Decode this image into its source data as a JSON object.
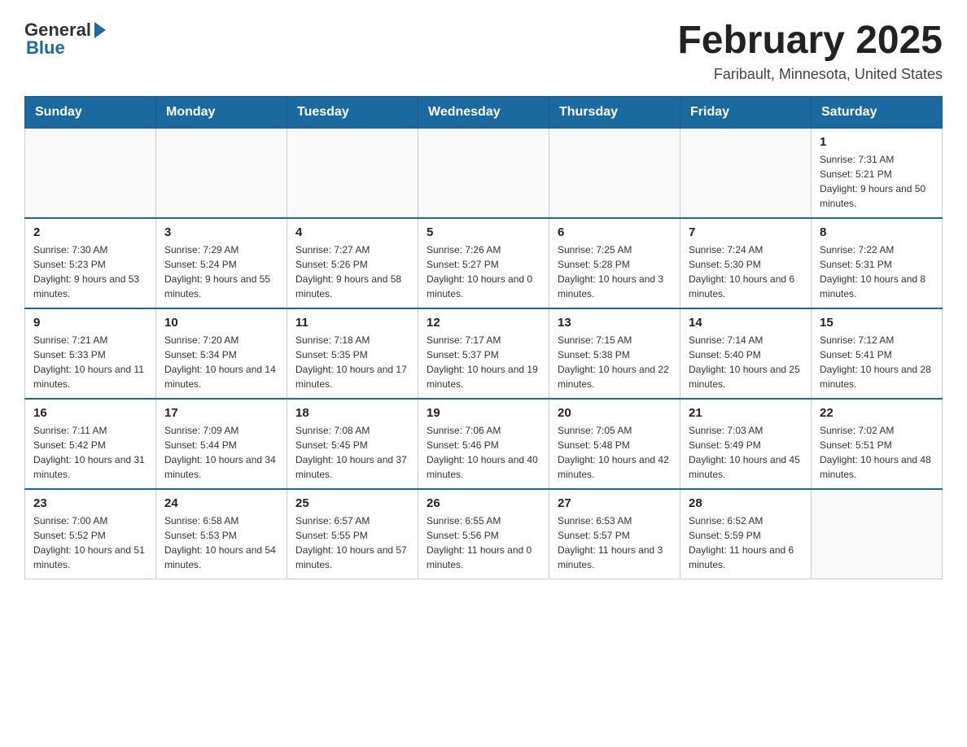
{
  "header": {
    "logo_general": "General",
    "logo_blue": "Blue",
    "month_year": "February 2025",
    "location": "Faribault, Minnesota, United States"
  },
  "days_of_week": [
    "Sunday",
    "Monday",
    "Tuesday",
    "Wednesday",
    "Thursday",
    "Friday",
    "Saturday"
  ],
  "weeks": [
    [
      {
        "day": "",
        "info": ""
      },
      {
        "day": "",
        "info": ""
      },
      {
        "day": "",
        "info": ""
      },
      {
        "day": "",
        "info": ""
      },
      {
        "day": "",
        "info": ""
      },
      {
        "day": "",
        "info": ""
      },
      {
        "day": "1",
        "info": "Sunrise: 7:31 AM\nSunset: 5:21 PM\nDaylight: 9 hours and 50 minutes."
      }
    ],
    [
      {
        "day": "2",
        "info": "Sunrise: 7:30 AM\nSunset: 5:23 PM\nDaylight: 9 hours and 53 minutes."
      },
      {
        "day": "3",
        "info": "Sunrise: 7:29 AM\nSunset: 5:24 PM\nDaylight: 9 hours and 55 minutes."
      },
      {
        "day": "4",
        "info": "Sunrise: 7:27 AM\nSunset: 5:26 PM\nDaylight: 9 hours and 58 minutes."
      },
      {
        "day": "5",
        "info": "Sunrise: 7:26 AM\nSunset: 5:27 PM\nDaylight: 10 hours and 0 minutes."
      },
      {
        "day": "6",
        "info": "Sunrise: 7:25 AM\nSunset: 5:28 PM\nDaylight: 10 hours and 3 minutes."
      },
      {
        "day": "7",
        "info": "Sunrise: 7:24 AM\nSunset: 5:30 PM\nDaylight: 10 hours and 6 minutes."
      },
      {
        "day": "8",
        "info": "Sunrise: 7:22 AM\nSunset: 5:31 PM\nDaylight: 10 hours and 8 minutes."
      }
    ],
    [
      {
        "day": "9",
        "info": "Sunrise: 7:21 AM\nSunset: 5:33 PM\nDaylight: 10 hours and 11 minutes."
      },
      {
        "day": "10",
        "info": "Sunrise: 7:20 AM\nSunset: 5:34 PM\nDaylight: 10 hours and 14 minutes."
      },
      {
        "day": "11",
        "info": "Sunrise: 7:18 AM\nSunset: 5:35 PM\nDaylight: 10 hours and 17 minutes."
      },
      {
        "day": "12",
        "info": "Sunrise: 7:17 AM\nSunset: 5:37 PM\nDaylight: 10 hours and 19 minutes."
      },
      {
        "day": "13",
        "info": "Sunrise: 7:15 AM\nSunset: 5:38 PM\nDaylight: 10 hours and 22 minutes."
      },
      {
        "day": "14",
        "info": "Sunrise: 7:14 AM\nSunset: 5:40 PM\nDaylight: 10 hours and 25 minutes."
      },
      {
        "day": "15",
        "info": "Sunrise: 7:12 AM\nSunset: 5:41 PM\nDaylight: 10 hours and 28 minutes."
      }
    ],
    [
      {
        "day": "16",
        "info": "Sunrise: 7:11 AM\nSunset: 5:42 PM\nDaylight: 10 hours and 31 minutes."
      },
      {
        "day": "17",
        "info": "Sunrise: 7:09 AM\nSunset: 5:44 PM\nDaylight: 10 hours and 34 minutes."
      },
      {
        "day": "18",
        "info": "Sunrise: 7:08 AM\nSunset: 5:45 PM\nDaylight: 10 hours and 37 minutes."
      },
      {
        "day": "19",
        "info": "Sunrise: 7:06 AM\nSunset: 5:46 PM\nDaylight: 10 hours and 40 minutes."
      },
      {
        "day": "20",
        "info": "Sunrise: 7:05 AM\nSunset: 5:48 PM\nDaylight: 10 hours and 42 minutes."
      },
      {
        "day": "21",
        "info": "Sunrise: 7:03 AM\nSunset: 5:49 PM\nDaylight: 10 hours and 45 minutes."
      },
      {
        "day": "22",
        "info": "Sunrise: 7:02 AM\nSunset: 5:51 PM\nDaylight: 10 hours and 48 minutes."
      }
    ],
    [
      {
        "day": "23",
        "info": "Sunrise: 7:00 AM\nSunset: 5:52 PM\nDaylight: 10 hours and 51 minutes."
      },
      {
        "day": "24",
        "info": "Sunrise: 6:58 AM\nSunset: 5:53 PM\nDaylight: 10 hours and 54 minutes."
      },
      {
        "day": "25",
        "info": "Sunrise: 6:57 AM\nSunset: 5:55 PM\nDaylight: 10 hours and 57 minutes."
      },
      {
        "day": "26",
        "info": "Sunrise: 6:55 AM\nSunset: 5:56 PM\nDaylight: 11 hours and 0 minutes."
      },
      {
        "day": "27",
        "info": "Sunrise: 6:53 AM\nSunset: 5:57 PM\nDaylight: 11 hours and 3 minutes."
      },
      {
        "day": "28",
        "info": "Sunrise: 6:52 AM\nSunset: 5:59 PM\nDaylight: 11 hours and 6 minutes."
      },
      {
        "day": "",
        "info": ""
      }
    ]
  ]
}
